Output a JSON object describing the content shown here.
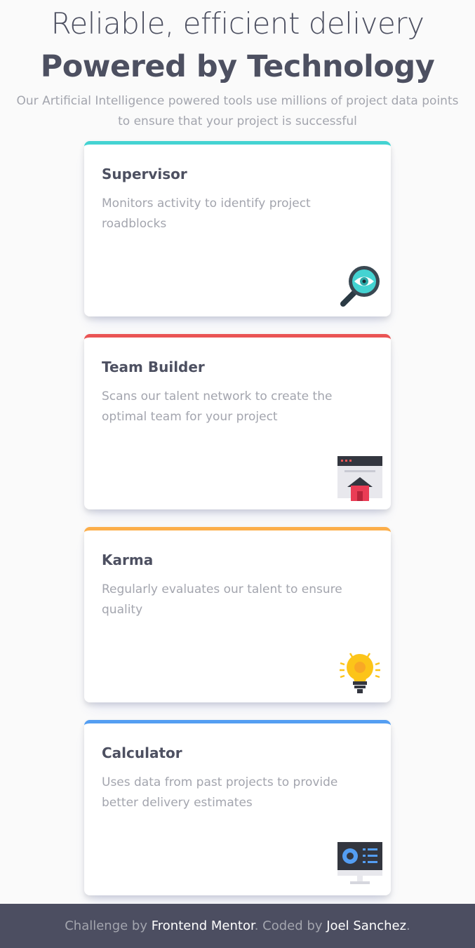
{
  "header": {
    "title_light": "Reliable, efficient delivery",
    "title_bold": "Powered by Technology",
    "subtitle": "Our Artificial Intelligence powered tools use millions of project data points to ensure that your project is successful"
  },
  "cards": [
    {
      "title": "Supervisor",
      "description": "Monitors activity to identify project roadblocks",
      "accent": "#44d3d2",
      "icon": "magnifier-eye-icon"
    },
    {
      "title": "Team Builder",
      "description": "Scans our talent network to create the optimal team for your project",
      "accent": "#ea5454",
      "icon": "browser-house-icon"
    },
    {
      "title": "Karma",
      "description": "Regularly evaluates our talent to ensure quality",
      "accent": "#fcae4a",
      "icon": "lightbulb-icon"
    },
    {
      "title": "Calculator",
      "description": "Uses data from past projects to provide better delivery estimates",
      "accent": "#549ef2",
      "icon": "monitor-calculator-icon"
    }
  ],
  "footer": {
    "prefix": "Challenge by ",
    "mentor_link": "Frontend Mentor",
    "middle": ". Coded by ",
    "author_link": "Joel Sanchez",
    "suffix": "."
  }
}
